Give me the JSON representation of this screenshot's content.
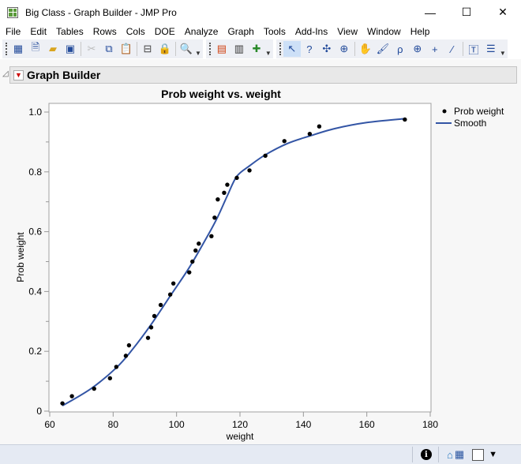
{
  "window": {
    "title": "Big Class - Graph Builder - JMP Pro",
    "minimize": "—",
    "maximize": "☐",
    "close": "✕"
  },
  "menu": [
    "File",
    "Edit",
    "Tables",
    "Rows",
    "Cols",
    "DOE",
    "Analyze",
    "Graph",
    "Tools",
    "Add-Ins",
    "View",
    "Window",
    "Help"
  ],
  "toolbar": {
    "icons": [
      "new-data-table",
      "new-script",
      "open",
      "save",
      "cut",
      "copy",
      "paste",
      "properties",
      "lock",
      "search",
      "data-table-view",
      "column-viewer",
      "add-rows",
      "arrow",
      "help",
      "crosshair",
      "lasso",
      "hand",
      "brush",
      "selection",
      "zoom",
      "plus",
      "ruler",
      "annotate",
      "more"
    ]
  },
  "outline": {
    "title": "Graph Builder"
  },
  "chart_data": {
    "type": "scatter",
    "title": "Prob weight vs. weight",
    "xlabel": "weight",
    "ylabel": "Prob weight",
    "xlim": [
      60,
      180
    ],
    "ylim": [
      0,
      1.0
    ],
    "xticks": [
      "60",
      "80",
      "100",
      "120",
      "140",
      "160",
      "180"
    ],
    "yticks": [
      "0",
      "0.2",
      "0.4",
      "0.6",
      "0.8",
      "1.0"
    ],
    "legend": [
      {
        "label": "Prob weight",
        "kind": "marker",
        "color": "#000000"
      },
      {
        "label": "Smooth",
        "kind": "line",
        "color": "#3355a5"
      }
    ],
    "legend_position": "right",
    "points": {
      "x": [
        64,
        67,
        74,
        79,
        81,
        84,
        85,
        91,
        92,
        93,
        95,
        98,
        99,
        104,
        105,
        106,
        107,
        111,
        112,
        113,
        115,
        116,
        119,
        123,
        128,
        134,
        142,
        145,
        172
      ],
      "y": [
        0.026,
        0.05,
        0.075,
        0.11,
        0.148,
        0.185,
        0.22,
        0.245,
        0.28,
        0.318,
        0.355,
        0.39,
        0.427,
        0.464,
        0.5,
        0.537,
        0.56,
        0.585,
        0.647,
        0.708,
        0.73,
        0.757,
        0.78,
        0.805,
        0.854,
        0.903,
        0.927,
        0.952,
        0.975
      ]
    },
    "smooth": {
      "x": [
        64,
        73,
        81,
        86,
        92,
        98,
        104,
        110,
        113,
        116,
        119,
        123,
        128,
        135,
        142,
        150,
        160,
        172
      ],
      "y": [
        0.018,
        0.075,
        0.145,
        0.205,
        0.29,
        0.385,
        0.48,
        0.59,
        0.65,
        0.72,
        0.785,
        0.82,
        0.857,
        0.895,
        0.92,
        0.945,
        0.965,
        0.978
      ]
    }
  },
  "status": {
    "info": "i",
    "dropdown": "▼"
  }
}
